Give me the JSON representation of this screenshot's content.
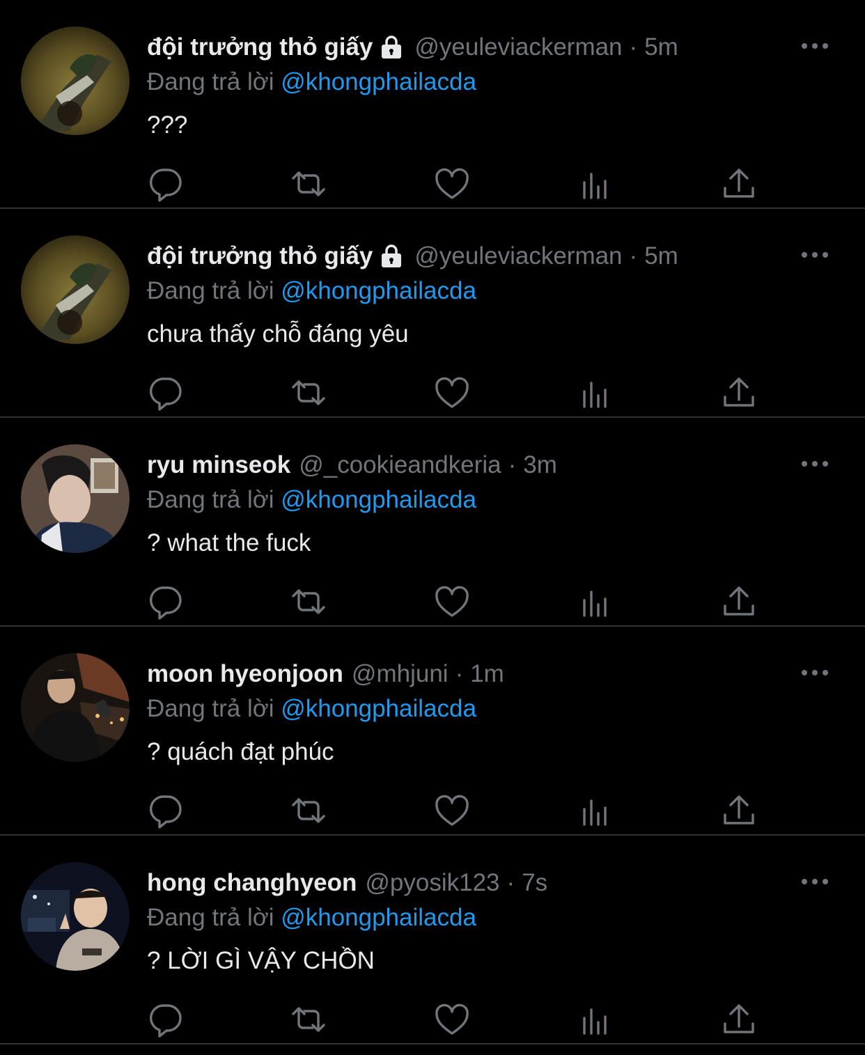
{
  "colors": {
    "background": "#000000",
    "text_primary": "#e7e9ea",
    "text_secondary": "#71767b",
    "accent": "#1d9bf0",
    "divider": "#2f3336"
  },
  "icons": {
    "protected": "lock-icon",
    "more": "more-horizontal-icon",
    "reply": "reply-icon",
    "retweet": "retweet-icon",
    "like": "heart-icon",
    "views": "views-icon",
    "share": "share-icon"
  },
  "tweets": [
    {
      "name": "đội trưởng thỏ giấy",
      "protected": true,
      "handle": "@yeuleviackerman",
      "separator": "·",
      "time": "5m",
      "reply_prefix": "Đang trả lời",
      "reply_handle": "@khongphailacda",
      "text": "???"
    },
    {
      "name": "đội trưởng thỏ giấy",
      "protected": true,
      "handle": "@yeuleviackerman",
      "separator": "·",
      "time": "5m",
      "reply_prefix": "Đang trả lời",
      "reply_handle": "@khongphailacda",
      "text": "chưa thấy chỗ đáng yêu"
    },
    {
      "name": "ryu minseok",
      "protected": false,
      "handle": "@_cookieandkeria",
      "separator": "·",
      "time": "3m",
      "reply_prefix": "Đang trả lời",
      "reply_handle": "@khongphailacda",
      "text": "? what the fuck"
    },
    {
      "name": "moon hyeonjoon",
      "protected": false,
      "handle": "@mhjuni",
      "separator": "·",
      "time": "1m",
      "reply_prefix": "Đang trả lời",
      "reply_handle": "@khongphailacda",
      "text": "? quách đạt phúc"
    },
    {
      "name": "hong changhyeon",
      "protected": false,
      "handle": "@pyosik123",
      "separator": "·",
      "time": "7s",
      "reply_prefix": "Đang trả lời",
      "reply_handle": "@khongphailacda",
      "text": "? LỜI GÌ VẬY CHỒN"
    }
  ]
}
